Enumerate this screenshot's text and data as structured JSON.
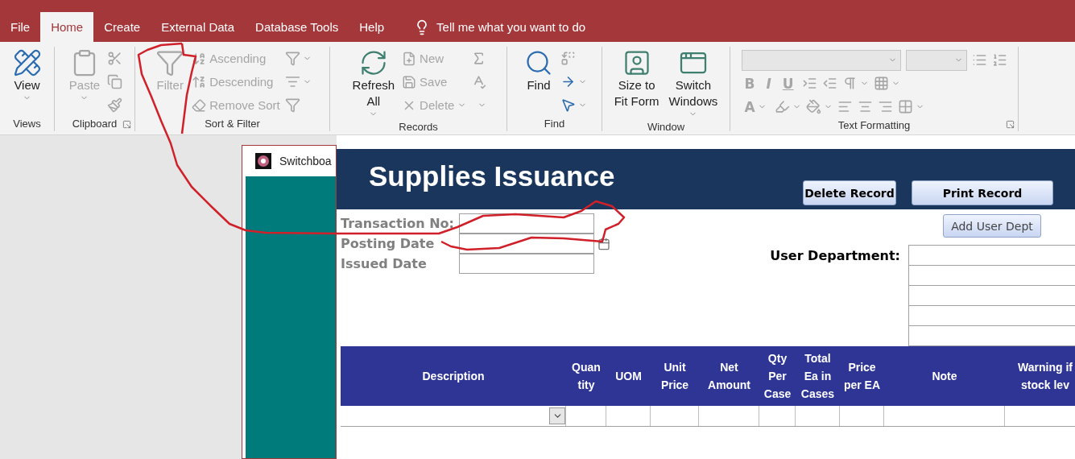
{
  "tabs": [
    {
      "label": "File",
      "selected": false
    },
    {
      "label": "Home",
      "selected": true
    },
    {
      "label": "Create",
      "selected": false
    },
    {
      "label": "External Data",
      "selected": false
    },
    {
      "label": "Database Tools",
      "selected": false
    },
    {
      "label": "Help",
      "selected": false
    }
  ],
  "tell_me": {
    "placeholder": "Tell me what you want to do"
  },
  "ribbon": {
    "groups": [
      {
        "label": "Views",
        "launcher": false,
        "items": [
          {
            "kind": "large",
            "label": "View",
            "disabled": false,
            "dropdown": true
          }
        ]
      },
      {
        "label": "Clipboard",
        "launcher": true,
        "items": [
          {
            "kind": "large",
            "label": "Paste",
            "disabled": true,
            "dropdown": true
          },
          {
            "kind": "icon",
            "disabled": true,
            "dropdown": false
          },
          {
            "kind": "icon",
            "disabled": true,
            "dropdown": false
          },
          {
            "kind": "icon",
            "disabled": true,
            "dropdown": false
          }
        ]
      },
      {
        "label": "Sort & Filter",
        "launcher": false,
        "items": [
          {
            "kind": "large",
            "label": "Filter",
            "disabled": true,
            "dropdown": false
          },
          {
            "kind": "small",
            "label": "Ascending",
            "disabled": true,
            "dropdown": false
          },
          {
            "kind": "small",
            "label": "Descending",
            "disabled": true,
            "dropdown": false
          },
          {
            "kind": "small",
            "label": "Remove Sort",
            "disabled": true,
            "dropdown": false
          },
          {
            "kind": "icon",
            "disabled": true,
            "dropdown": true
          },
          {
            "kind": "icon",
            "disabled": true,
            "dropdown": true
          },
          {
            "kind": "icon",
            "disabled": true,
            "dropdown": false
          }
        ]
      },
      {
        "label": "Records",
        "launcher": false,
        "items": [
          {
            "kind": "large",
            "label": "Refresh\nAll",
            "disabled": false,
            "dropdown": true
          },
          {
            "kind": "small",
            "label": "New",
            "disabled": true,
            "dropdown": false
          },
          {
            "kind": "small",
            "label": "Save",
            "disabled": true,
            "dropdown": false
          },
          {
            "kind": "small",
            "label": "Delete",
            "disabled": true,
            "dropdown": true
          },
          {
            "kind": "icon",
            "disabled": true,
            "dropdown": false
          },
          {
            "kind": "icon",
            "disabled": true,
            "dropdown": false
          },
          {
            "kind": "icon",
            "disabled": true,
            "dropdown": true
          }
        ]
      },
      {
        "label": "Find",
        "launcher": false,
        "items": [
          {
            "kind": "large",
            "label": "Find",
            "disabled": false,
            "dropdown": false
          },
          {
            "kind": "icon",
            "disabled": true,
            "dropdown": false
          },
          {
            "kind": "icon",
            "disabled": false,
            "dropdown": true
          },
          {
            "kind": "icon",
            "disabled": false,
            "dropdown": true
          }
        ]
      },
      {
        "label": "Window",
        "launcher": false,
        "items": [
          {
            "kind": "large",
            "label": "Size to\nFit Form",
            "disabled": false,
            "dropdown": false
          },
          {
            "kind": "large",
            "label": "Switch\nWindows",
            "disabled": false,
            "dropdown": true
          }
        ]
      },
      {
        "label": "Text Formatting",
        "launcher": true,
        "items": [
          {
            "kind": "combo",
            "disabled": true,
            "dropdown": true
          },
          {
            "kind": "combo",
            "disabled": true,
            "dropdown": true
          },
          {
            "kind": "icon",
            "disabled": true,
            "dropdown": false
          },
          {
            "kind": "icon",
            "disabled": true,
            "dropdown": false
          },
          {
            "kind": "glyph",
            "label": "B",
            "disabled": true,
            "dropdown": false
          },
          {
            "kind": "glyph",
            "label": "I",
            "disabled": true,
            "dropdown": false
          },
          {
            "kind": "glyph",
            "label": "U",
            "disabled": true,
            "dropdown": false
          },
          {
            "kind": "icon",
            "disabled": true,
            "dropdown": false
          },
          {
            "kind": "icon",
            "disabled": true,
            "dropdown": false
          },
          {
            "kind": "icon",
            "disabled": true,
            "dropdown": true
          },
          {
            "kind": "icon",
            "disabled": true,
            "dropdown": true
          },
          {
            "kind": "glyph",
            "label": "A",
            "disabled": true,
            "dropdown": true
          },
          {
            "kind": "icon",
            "disabled": true,
            "dropdown": true
          },
          {
            "kind": "icon",
            "disabled": true,
            "dropdown": true
          },
          {
            "kind": "icon",
            "disabled": true,
            "dropdown": false
          },
          {
            "kind": "icon",
            "disabled": true,
            "dropdown": false
          },
          {
            "kind": "icon",
            "disabled": true,
            "dropdown": false
          },
          {
            "kind": "icon",
            "disabled": true,
            "dropdown": true
          }
        ]
      }
    ]
  },
  "switchboard": {
    "title": "Switchboa"
  },
  "form": {
    "title": "Supplies Issuance",
    "header_buttons": [
      "Delete Record",
      "Print Record"
    ],
    "fields": [
      {
        "label": "Transaction No:",
        "calendar": false
      },
      {
        "label": "Posting Date",
        "calendar": true
      },
      {
        "label": "Issued Date",
        "calendar": false
      }
    ],
    "add_button": "Add User Dept",
    "user_department": {
      "label": "User Department:"
    },
    "table": {
      "columns": [
        "Description",
        "Quan\ntity",
        "UOM",
        "Unit\nPrice",
        "Net\nAmount",
        "Qty\nPer\nCase",
        "Total\nEa in\nCases",
        "Price\nper EA",
        "Note",
        "Warning if\nstock lev"
      ]
    }
  }
}
